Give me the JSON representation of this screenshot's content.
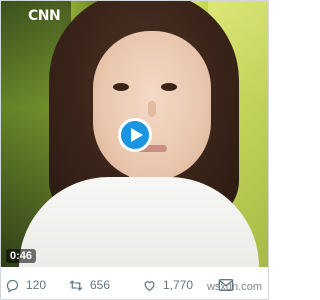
{
  "video": {
    "logo_text": "CNN",
    "duration": "0:46",
    "play_icon": "play-icon"
  },
  "actions": {
    "reply_count": "120",
    "retweet_count": "656",
    "like_count": "1,770"
  },
  "watermark": "wsxdn.com",
  "colors": {
    "play_accent": "#1b95e0",
    "action_gray": "#657786"
  }
}
